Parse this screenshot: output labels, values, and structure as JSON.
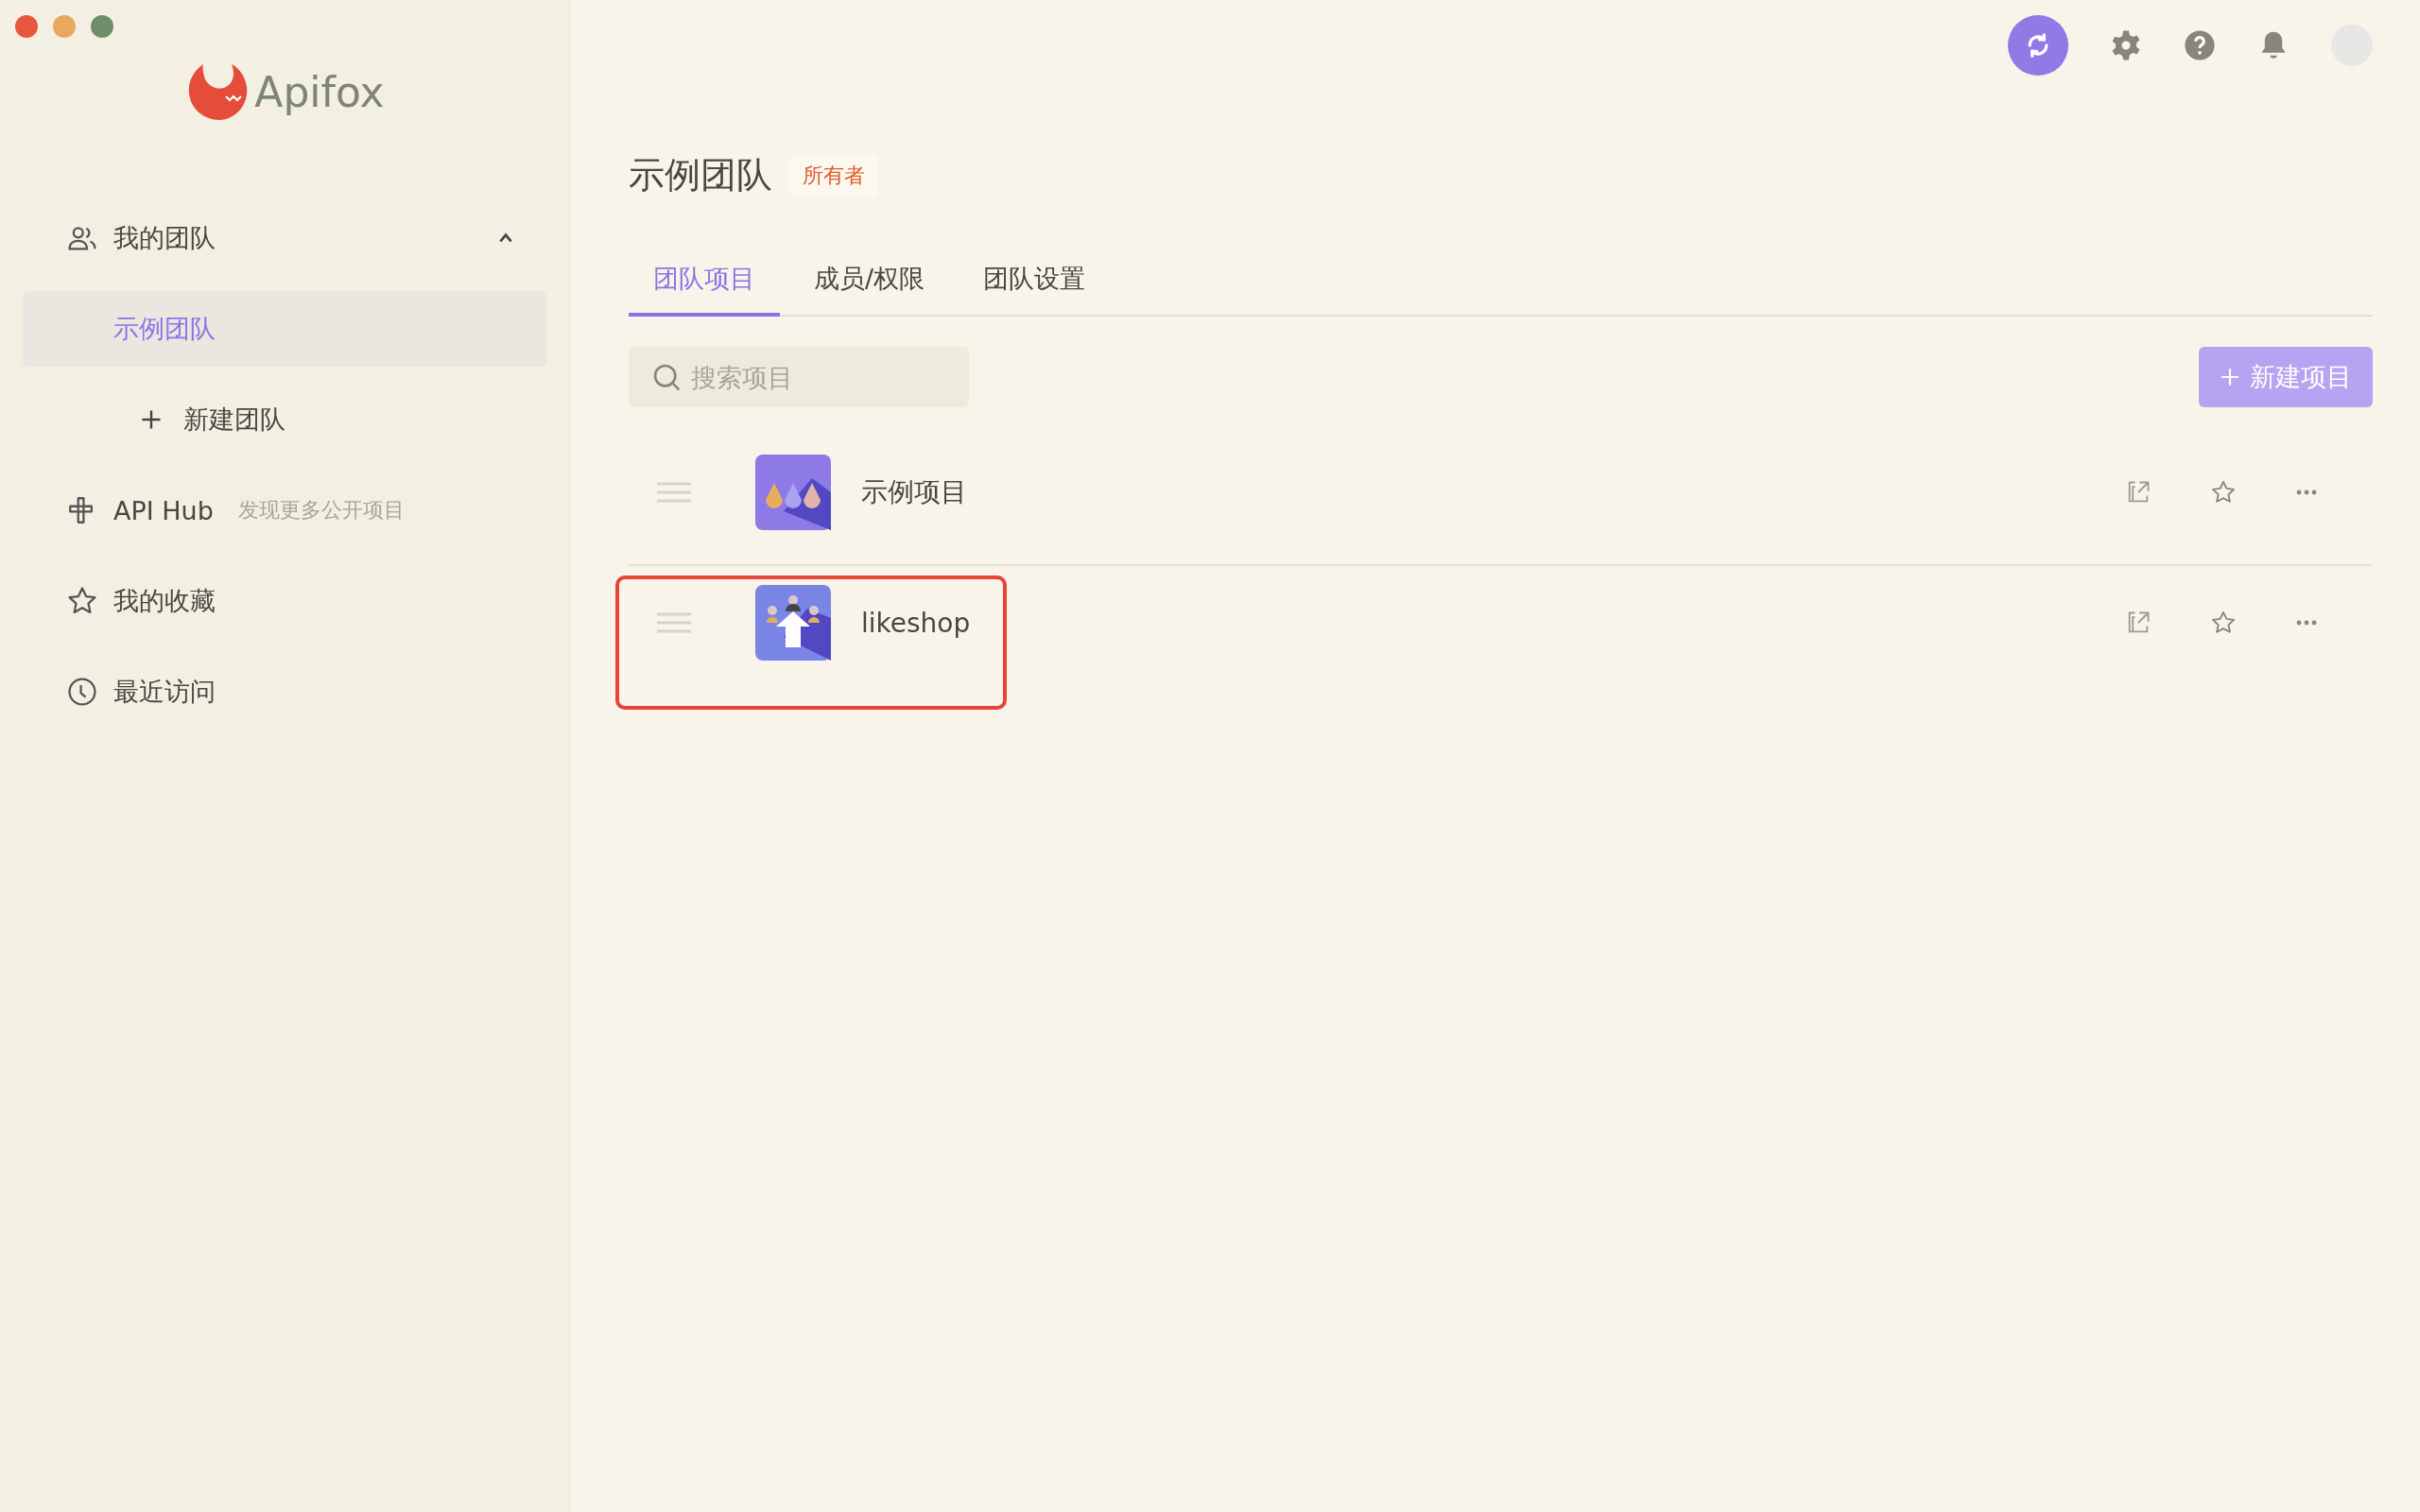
{
  "window": {
    "traffic_lights": [
      {
        "color": "#e5583f"
      },
      {
        "color": "#e9a85e"
      },
      {
        "color": "#6e8e6a"
      }
    ]
  },
  "logo": {
    "text": "Apifox"
  },
  "sidebar": {
    "items": [
      {
        "kind": "group",
        "label": "我的团队",
        "expanded": true,
        "children": [
          {
            "kind": "team",
            "label": "示例团队",
            "selected": true
          },
          {
            "kind": "add",
            "label": "新建团队",
            "selected": false
          }
        ]
      },
      {
        "kind": "link",
        "label": "API Hub",
        "hint": "发现更多公开项目"
      },
      {
        "kind": "link",
        "label": "我的收藏"
      },
      {
        "kind": "link",
        "label": "最近访问"
      }
    ]
  },
  "team": {
    "name": "示例团队",
    "role": "所有者"
  },
  "tabs": [
    {
      "label": "团队项目",
      "selected": true
    },
    {
      "label": "成员/权限",
      "selected": false
    },
    {
      "label": "团队设置",
      "selected": false
    }
  ],
  "search": {
    "placeholder": "搜索项目"
  },
  "new_project_button": {
    "label": "新建项目"
  },
  "projects": [
    {
      "name": "示例项目",
      "highlighted": false
    },
    {
      "name": "likeshop",
      "highlighted": true
    }
  ]
}
